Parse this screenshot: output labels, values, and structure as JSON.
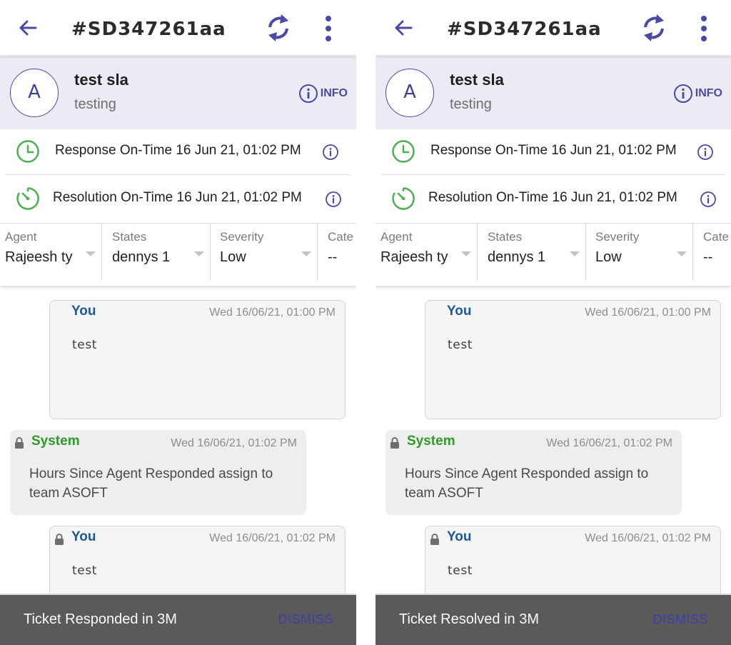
{
  "screens": [
    {
      "header": {
        "title": "#SD347261aa"
      },
      "customer": {
        "avatar_letter": "A",
        "name": "test sla",
        "subtitle": "testing",
        "info_label": "INFO"
      },
      "sla": [
        {
          "text": "Response On-Time 16 Jun 21, 01:02 PM"
        },
        {
          "text": "Resolution On-Time 16 Jun 21, 01:02 PM"
        }
      ],
      "fields": [
        {
          "label": "Agent",
          "value": "Rajeesh ty"
        },
        {
          "label": "States",
          "value": "dennys 1"
        },
        {
          "label": "Severity",
          "value": "Low"
        },
        {
          "label": "Cate",
          "value": "--"
        }
      ],
      "messages": [
        {
          "author": "You",
          "time": "Wed 16/06/21, 01:00 PM",
          "body": "test"
        },
        {
          "author": "System",
          "time": "Wed 16/06/21, 01:02 PM",
          "body": "Hours Since Agent Responded assign to team ASOFT"
        },
        {
          "author": "You",
          "time": "Wed 16/06/21, 01:02 PM",
          "body": "test"
        }
      ],
      "snackbar": {
        "text": "Ticket Responded in 3M",
        "action": "DISMISS"
      }
    },
    {
      "header": {
        "title": "#SD347261aa"
      },
      "customer": {
        "avatar_letter": "A",
        "name": "test sla",
        "subtitle": "testing",
        "info_label": "INFO"
      },
      "sla": [
        {
          "text": "Response On-Time 16 Jun 21, 01:02 PM"
        },
        {
          "text": "Resolution On-Time 16 Jun 21, 01:02 PM"
        }
      ],
      "fields": [
        {
          "label": "Agent",
          "value": "Rajeesh ty"
        },
        {
          "label": "States",
          "value": "dennys 1"
        },
        {
          "label": "Severity",
          "value": "Low"
        },
        {
          "label": "Cate",
          "value": "--"
        }
      ],
      "messages": [
        {
          "author": "You",
          "time": "Wed 16/06/21, 01:00 PM",
          "body": "test"
        },
        {
          "author": "System",
          "time": "Wed 16/06/21, 01:02 PM",
          "body": "Hours Since Agent Responded assign to team ASOFT"
        },
        {
          "author": "You",
          "time": "Wed 16/06/21, 01:02 PM",
          "body": "test"
        }
      ],
      "snackbar": {
        "text": "Ticket Resolved in 3M",
        "action": "DISMISS"
      }
    }
  ],
  "colors": {
    "accent": "#4a4aa6",
    "customer_bg": "#eceaf4",
    "sla_green": "#4caf50",
    "you_author": "#1d5a9c",
    "system_author": "#2e9a2a",
    "snackbar_bg": "#5a5a5a",
    "dismiss": "#3e3ea8"
  },
  "icons": {
    "back": "arrow-left-icon",
    "sync": "sync-icon",
    "more": "more-vert-icon",
    "info": "info-circle-icon",
    "sla_response": "clock-icon",
    "sla_resolution": "timer-icon",
    "lock": "lock-icon",
    "caret": "dropdown-caret-icon"
  }
}
